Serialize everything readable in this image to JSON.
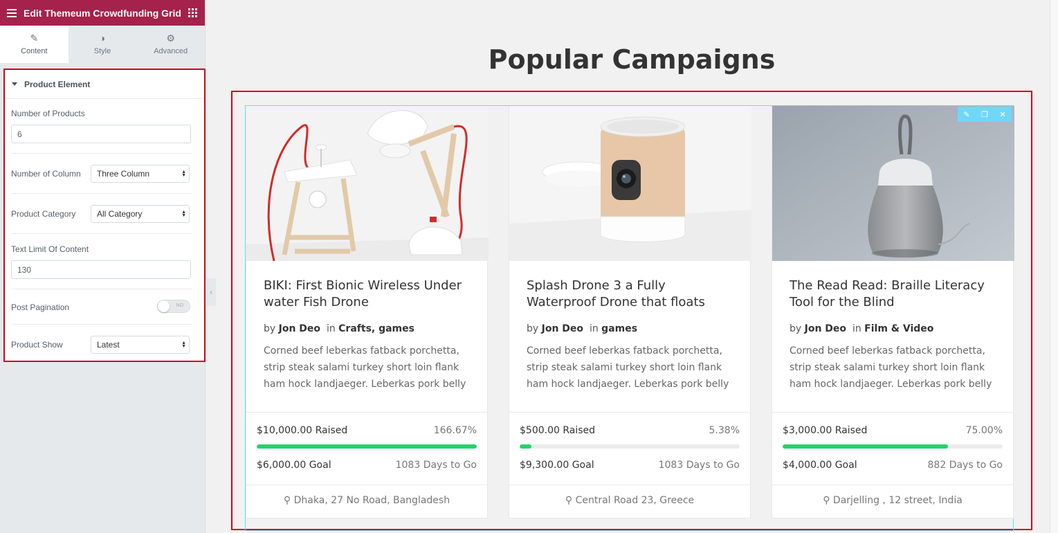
{
  "panel": {
    "title": "Edit Themeum Crowdfunding Grid",
    "tabs": [
      {
        "label": "Content",
        "icon": "pencil-icon"
      },
      {
        "label": "Style",
        "icon": "half-circle-icon"
      },
      {
        "label": "Advanced",
        "icon": "gear-icon"
      }
    ],
    "section": {
      "title": "Product Element",
      "number_of_products_label": "Number of Products",
      "number_of_products_value": "6",
      "number_of_column_label": "Number of Column",
      "number_of_column_value": "Three Column",
      "product_category_label": "Product Category",
      "product_category_value": "All Category",
      "text_limit_label": "Text Limit Of Content",
      "text_limit_value": "130",
      "post_pagination_label": "Post Pagination",
      "post_pagination_state": "NO",
      "product_show_label": "Product Show",
      "product_show_value": "Latest"
    },
    "accent_color": "#a4224c"
  },
  "preview": {
    "heading": "Popular Campaigns",
    "highlight_color": "#d0021b",
    "progress_color": "#20d46b",
    "cards": [
      {
        "title": "BIKI: First Bionic Wireless Under water Fish Drone",
        "by": "by",
        "author": "Jon Deo",
        "in": "in",
        "categories": "Crafts, games",
        "desc": "Corned beef leberkas fatback porchetta, strip steak salami turkey short loin flank ham hock landjaeger. Leberkas pork belly",
        "raised": "$10,000.00 Raised",
        "percent": "166.67%",
        "progress_fraction": 1.0,
        "goal": "$6,000.00 Goal",
        "days": "1083 Days to Go",
        "location": "Dhaka, 27 No Road, Bangladesh",
        "image": "desk-lamp-image"
      },
      {
        "title": "Splash Drone 3 a Fully Waterproof Drone that floats",
        "by": "by",
        "author": "Jon Deo",
        "in": "in",
        "categories": "games",
        "desc": "Corned beef leberkas fatback porchetta, strip steak salami turkey short loin flank ham hock landjaeger. Leberkas pork belly",
        "raised": "$500.00 Raised",
        "percent": "5.38%",
        "progress_fraction": 0.0538,
        "goal": "$9,300.00 Goal",
        "days": "1083 Days to Go",
        "location": "Central Road 23, Greece",
        "image": "home-camera-image"
      },
      {
        "title": "The Read Read: Braille Literacy Tool for the Blind",
        "by": "by",
        "author": "Jon Deo",
        "in": "in",
        "categories": "Film & Video",
        "desc": "Corned beef leberkas fatback porchetta, strip steak salami turkey short loin flank ham hock landjaeger. Leberkas pork belly",
        "raised": "$3,000.00 Raised",
        "percent": "75.00%",
        "progress_fraction": 0.75,
        "goal": "$4,000.00 Goal",
        "days": "882 Days to Go",
        "location": "Darjelling , 12 street, India",
        "image": "smart-speaker-image"
      }
    ]
  }
}
